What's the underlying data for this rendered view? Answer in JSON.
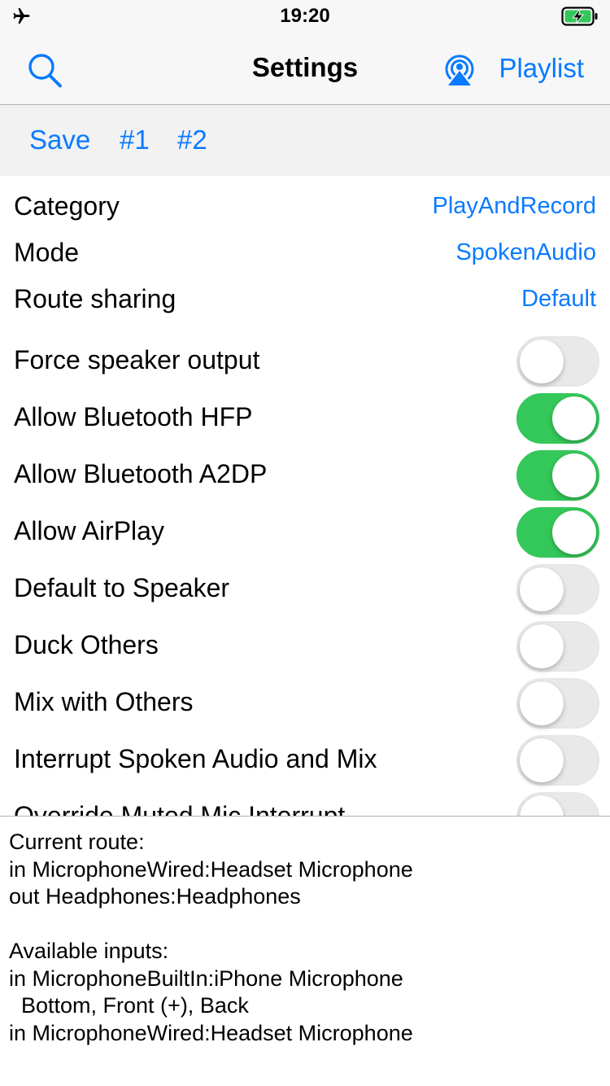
{
  "status_bar": {
    "time": "19:20",
    "airplane_icon": "airplane-icon",
    "battery_icon": "battery-charging-icon"
  },
  "nav": {
    "title": "Settings",
    "left_icon": "search-icon",
    "airplay_icon": "airplay-icon",
    "right_label": "Playlist"
  },
  "toolbar": {
    "save_label": "Save",
    "preset1_label": "#1",
    "preset2_label": "#2"
  },
  "settings": {
    "category": {
      "label": "Category",
      "value": "PlayAndRecord"
    },
    "mode": {
      "label": "Mode",
      "value": "SpokenAudio"
    },
    "route_sharing": {
      "label": "Route sharing",
      "value": "Default"
    },
    "toggles": [
      {
        "label": "Force speaker output",
        "on": false
      },
      {
        "label": "Allow Bluetooth HFP",
        "on": true
      },
      {
        "label": "Allow Bluetooth A2DP",
        "on": true
      },
      {
        "label": "Allow AirPlay",
        "on": true
      },
      {
        "label": "Default to Speaker",
        "on": false
      },
      {
        "label": "Duck Others",
        "on": false
      },
      {
        "label": "Mix with Others",
        "on": false
      },
      {
        "label": "Interrupt Spoken Audio and Mix",
        "on": false
      },
      {
        "label": "Override Muted Mic Interrupt",
        "on": false
      }
    ]
  },
  "info": {
    "lines": [
      "Current route:",
      "in MicrophoneWired:Headset Microphone",
      "out Headphones:Headphones",
      "",
      "Available inputs:",
      "in MicrophoneBuiltIn:iPhone Microphone",
      "  Bottom, Front (+), Back",
      "in MicrophoneWired:Headset Microphone"
    ]
  },
  "colors": {
    "accent": "#0a7aff",
    "toggle_on": "#34c759",
    "toggle_off": "#e9e9ea",
    "bar_bg": "#f7f7f7",
    "toolbar_bg": "#f2f2f2"
  }
}
